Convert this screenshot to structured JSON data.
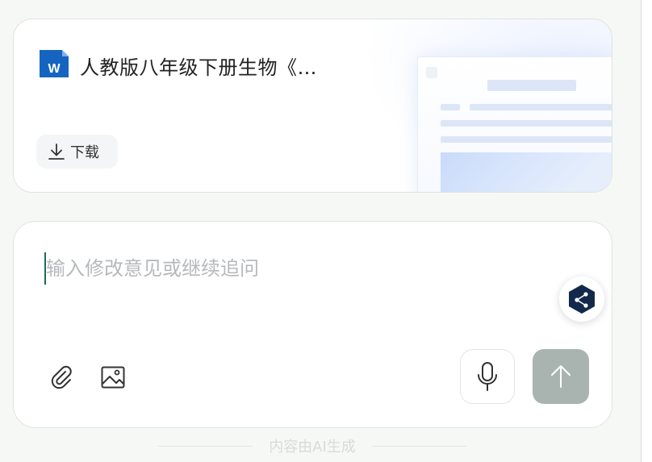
{
  "file_card": {
    "file_type_letter": "W",
    "title": "人教版八年级下册生物《…",
    "download_label": "下载",
    "accent_color": "#1565c0"
  },
  "composer": {
    "placeholder": "输入修改意见或继续追问",
    "value": ""
  },
  "footer": {
    "note": "内容由AI生成"
  },
  "icons": {
    "file": "word-doc-icon",
    "download": "download-icon",
    "attach": "paperclip-icon",
    "image": "image-icon",
    "mic": "microphone-icon",
    "send": "arrow-up-icon",
    "share": "share-hex-icon"
  }
}
